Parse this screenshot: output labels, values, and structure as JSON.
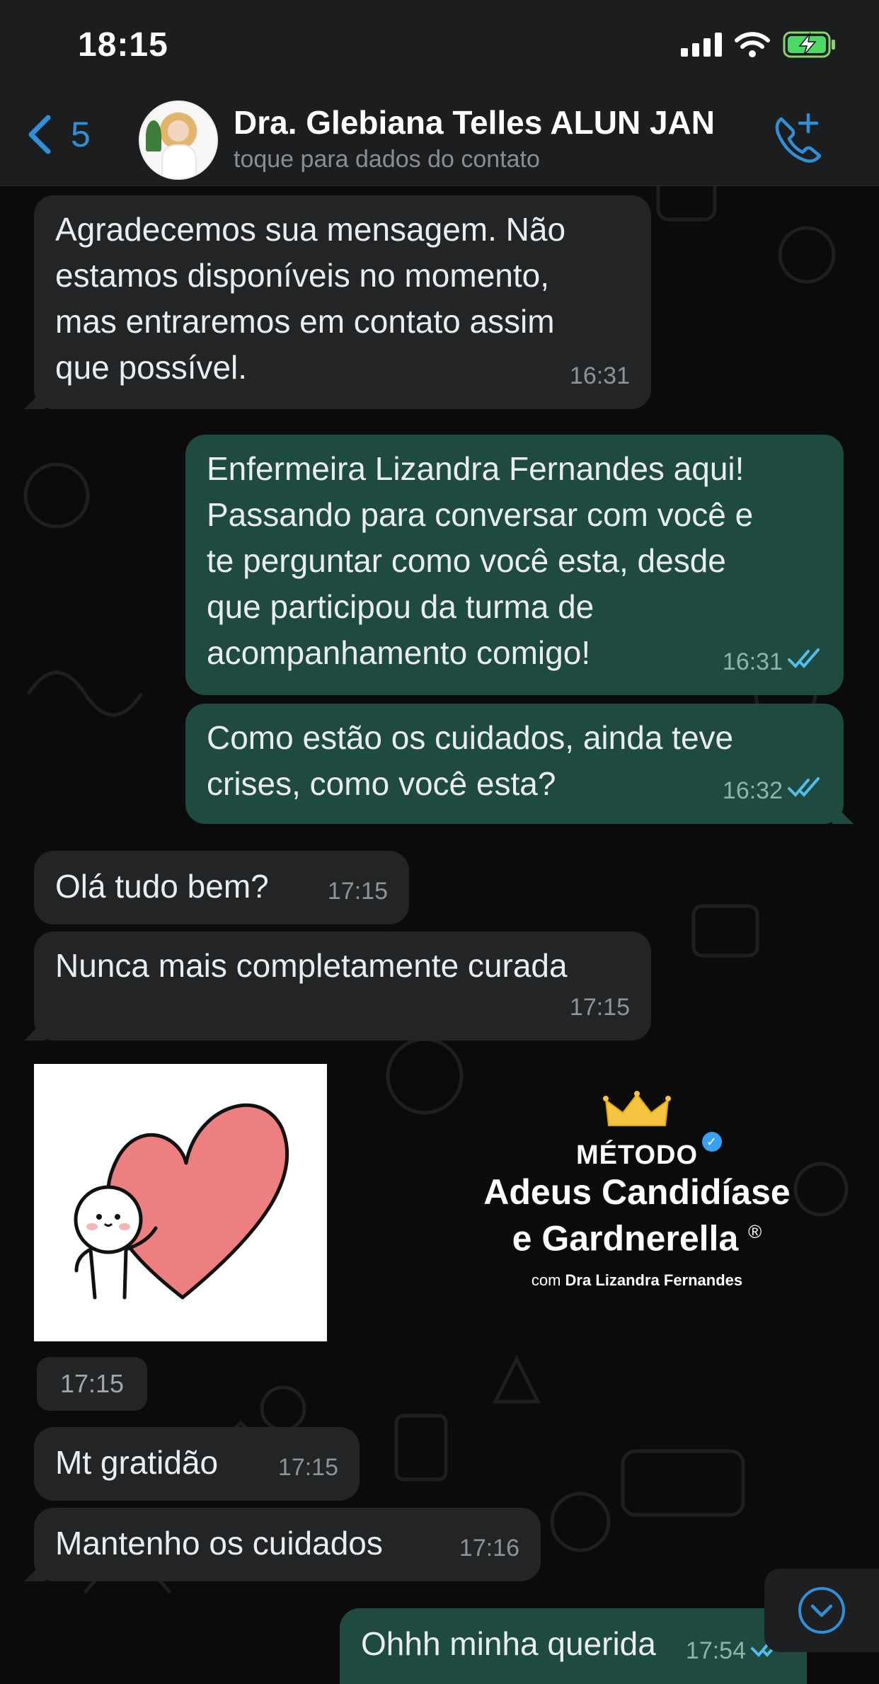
{
  "status_bar": {
    "time": "18:15"
  },
  "header": {
    "back_count": "5",
    "contact_name": "Dra. Glebiana Telles ALUN JAN",
    "contact_subtitle": "toque para dados do contato"
  },
  "messages": [
    {
      "direction": "in",
      "text": "Agradecemos sua mensagem. Não\nestamos disponíveis no momento,\nmas entraremos em contato assim\nque possível.",
      "time": "16:31"
    },
    {
      "direction": "out",
      "text": "Enfermeira Lizandra Fernandes aqui!\nPassando para conversar com você e\nte perguntar como você esta, desde\nque participou da turma de\nacompanhamento comigo!",
      "time": "16:31",
      "status": "read"
    },
    {
      "direction": "out",
      "text": "Como estão os cuidados, ainda teve\ncrises, como você esta?",
      "time": "16:32",
      "status": "read"
    },
    {
      "direction": "in",
      "text": "Olá tudo bem?",
      "time": "17:15"
    },
    {
      "direction": "in",
      "text": "Nunca mais completamente curada",
      "time": "17:15"
    },
    {
      "direction": "in",
      "type": "sticker",
      "sticker": "heart-sticker",
      "time": "17:15"
    },
    {
      "direction": "in",
      "text": "Mt gratidão",
      "time": "17:15"
    },
    {
      "direction": "in",
      "text": "Mantenho os cuidados",
      "time": "17:16"
    },
    {
      "direction": "out",
      "text": "Ohhh minha querida",
      "time": "17:54",
      "status": "read"
    }
  ],
  "watermark": {
    "line1": "MÉTODO",
    "line2": "Adeus Candidíase",
    "line3": "e Gardnerella",
    "registered": "®",
    "line4_prefix": "com",
    "line4_name": "Dra Lizandra Fernandes"
  },
  "colors": {
    "accent": "#2f8fd8",
    "incoming_bubble": "#232425",
    "outgoing_bubble": "#1e4a3f",
    "read_tick": "#53bdeb"
  },
  "icons": [
    "back-chevron-icon",
    "add-call-icon",
    "signal-icon",
    "wifi-icon",
    "battery-charging-icon",
    "double-check-icon",
    "chevron-down-icon",
    "crown-icon",
    "verified-badge-icon"
  ]
}
